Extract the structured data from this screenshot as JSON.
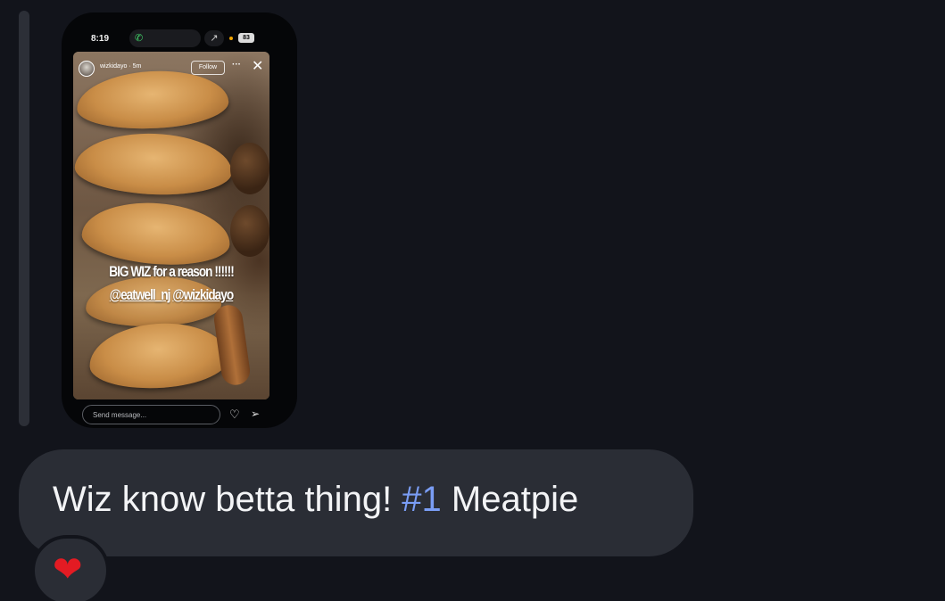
{
  "phone_status": {
    "time": "8:19",
    "call_indicator": "phone-icon",
    "share_indicator": "location-arrow-icon",
    "battery": "83"
  },
  "story": {
    "username": "wizkidayo",
    "age": "5m",
    "follow_label": "Follow",
    "more_label": "···",
    "close_label": "✕",
    "caption_line1": "BIG WIZ for a reason !!!!!!",
    "caption_mention1": "@eatwell_nj",
    "caption_mention2": "@wizkidayo",
    "send_placeholder": "Send message..."
  },
  "message": {
    "text_before": "Wiz know betta thing! ",
    "hashtag": "#1",
    "text_after": " Meatpie"
  },
  "reaction": {
    "emoji": "❤",
    "icon": "red-heart-icon"
  },
  "colors": {
    "background": "#12141b",
    "bubble": "#2a2d35",
    "hashtag": "#7a9df5"
  }
}
